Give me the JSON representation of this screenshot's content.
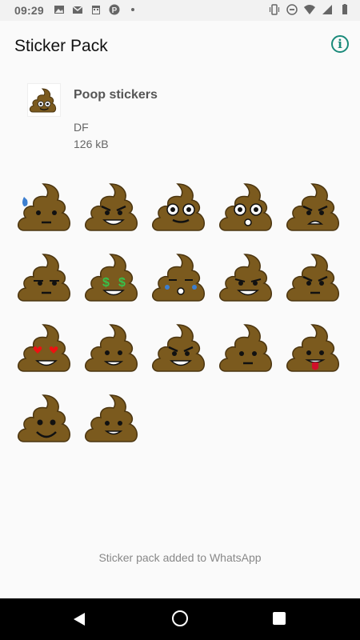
{
  "status_bar": {
    "time": "09:29",
    "left_icons": [
      "image-icon",
      "gmail-icon",
      "calendar-icon",
      "p-icon",
      "dot-icon"
    ],
    "right_icons": [
      "vibrate-icon",
      "do-not-disturb-icon",
      "wifi-icon",
      "signal-icon",
      "battery-icon"
    ]
  },
  "app_bar": {
    "title": "Sticker Pack",
    "info_icon": "info-icon",
    "info_glyph": "i"
  },
  "pack": {
    "name": "Poop stickers",
    "publisher": "DF",
    "size": "126 kB"
  },
  "stickers": [
    {
      "name": "sweat"
    },
    {
      "name": "grin"
    },
    {
      "name": "wide-eyes"
    },
    {
      "name": "surprised"
    },
    {
      "name": "angry"
    },
    {
      "name": "unamused"
    },
    {
      "name": "money-eyes"
    },
    {
      "name": "crying"
    },
    {
      "name": "smirk"
    },
    {
      "name": "frown"
    },
    {
      "name": "heart-eyes"
    },
    {
      "name": "smile"
    },
    {
      "name": "evil-grin"
    },
    {
      "name": "neutral"
    },
    {
      "name": "tongue"
    },
    {
      "name": "happy"
    },
    {
      "name": "grin-small"
    }
  ],
  "footer_text": "Sticker pack added to WhatsApp",
  "colors": {
    "accent": "#1a8a7a",
    "poop": "#7b5a1e",
    "poop_outline": "#4b3510"
  }
}
